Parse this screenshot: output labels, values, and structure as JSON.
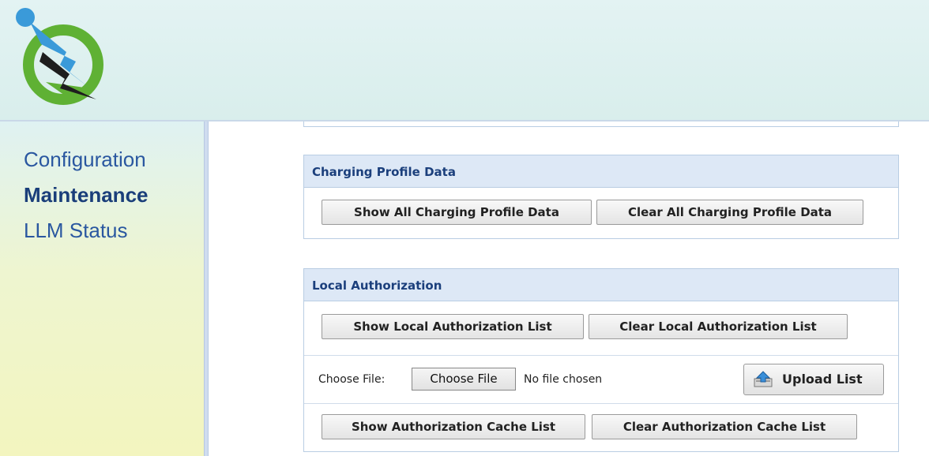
{
  "sidebar": {
    "items": [
      {
        "label": "Configuration"
      },
      {
        "label": "Maintenance"
      },
      {
        "label": "LLM Status"
      }
    ]
  },
  "panels": {
    "charging_profile": {
      "title": "Charging Profile Data",
      "show_button": "Show All Charging Profile Data",
      "clear_button": "Clear All Charging Profile Data"
    },
    "local_auth": {
      "title": "Local Authorization",
      "show_list_button": "Show Local Authorization List",
      "clear_list_button": "Clear Local Authorization List",
      "file_label": "Choose File:",
      "choose_file_button": "Choose File",
      "file_status": "No file chosen",
      "upload_button": "Upload List",
      "show_cache_button": "Show Authorization Cache List",
      "clear_cache_button": "Clear Authorization Cache List"
    }
  },
  "colors": {
    "accent": "#1b3f7c",
    "nav_link": "#2a57a0",
    "panel_header_bg": "#dde8f6"
  }
}
